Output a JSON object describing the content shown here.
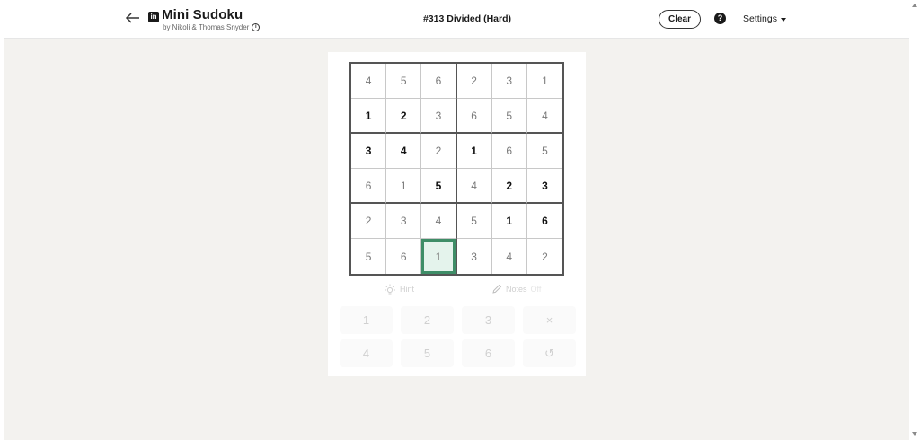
{
  "header": {
    "title": "Mini Sudoku",
    "logo_text": "in",
    "byline": "by Nikoli & Thomas Snyder",
    "info_glyph": "i",
    "puzzle_name": "#313 Divided (Hard)",
    "clear_label": "Clear",
    "help_glyph": "?",
    "settings_label": "Settings"
  },
  "board": {
    "rows": [
      [
        {
          "v": "4",
          "given": false
        },
        {
          "v": "5",
          "given": false
        },
        {
          "v": "6",
          "given": false
        },
        {
          "v": "2",
          "given": false
        },
        {
          "v": "3",
          "given": false
        },
        {
          "v": "1",
          "given": false
        }
      ],
      [
        {
          "v": "1",
          "given": true
        },
        {
          "v": "2",
          "given": true
        },
        {
          "v": "3",
          "given": false
        },
        {
          "v": "6",
          "given": false
        },
        {
          "v": "5",
          "given": false
        },
        {
          "v": "4",
          "given": false
        }
      ],
      [
        {
          "v": "3",
          "given": true
        },
        {
          "v": "4",
          "given": true
        },
        {
          "v": "2",
          "given": false
        },
        {
          "v": "1",
          "given": true
        },
        {
          "v": "6",
          "given": false
        },
        {
          "v": "5",
          "given": false
        }
      ],
      [
        {
          "v": "6",
          "given": false
        },
        {
          "v": "1",
          "given": false
        },
        {
          "v": "5",
          "given": true
        },
        {
          "v": "4",
          "given": false
        },
        {
          "v": "2",
          "given": true
        },
        {
          "v": "3",
          "given": true
        }
      ],
      [
        {
          "v": "2",
          "given": false
        },
        {
          "v": "3",
          "given": false
        },
        {
          "v": "4",
          "given": false
        },
        {
          "v": "5",
          "given": false
        },
        {
          "v": "1",
          "given": true
        },
        {
          "v": "6",
          "given": true
        }
      ],
      [
        {
          "v": "5",
          "given": false
        },
        {
          "v": "6",
          "given": false
        },
        {
          "v": "1",
          "given": false
        },
        {
          "v": "3",
          "given": false
        },
        {
          "v": "4",
          "given": false
        },
        {
          "v": "2",
          "given": false
        }
      ]
    ],
    "selected": {
      "row": 5,
      "col": 2
    }
  },
  "tools": {
    "hint_label": "Hint",
    "notes_label": "Notes",
    "notes_state": "Off"
  },
  "pad": {
    "keys": [
      "1",
      "2",
      "3",
      "×",
      "4",
      "5",
      "6",
      "↺"
    ],
    "key_names": [
      "pad-key-1",
      "pad-key-2",
      "pad-key-3",
      "erase-button",
      "pad-key-4",
      "pad-key-5",
      "pad-key-6",
      "undo-button"
    ]
  },
  "colors": {
    "selected_border": "#3e8d67",
    "selected_fill": "#e4f3ec",
    "background": "#f3f2ef"
  }
}
